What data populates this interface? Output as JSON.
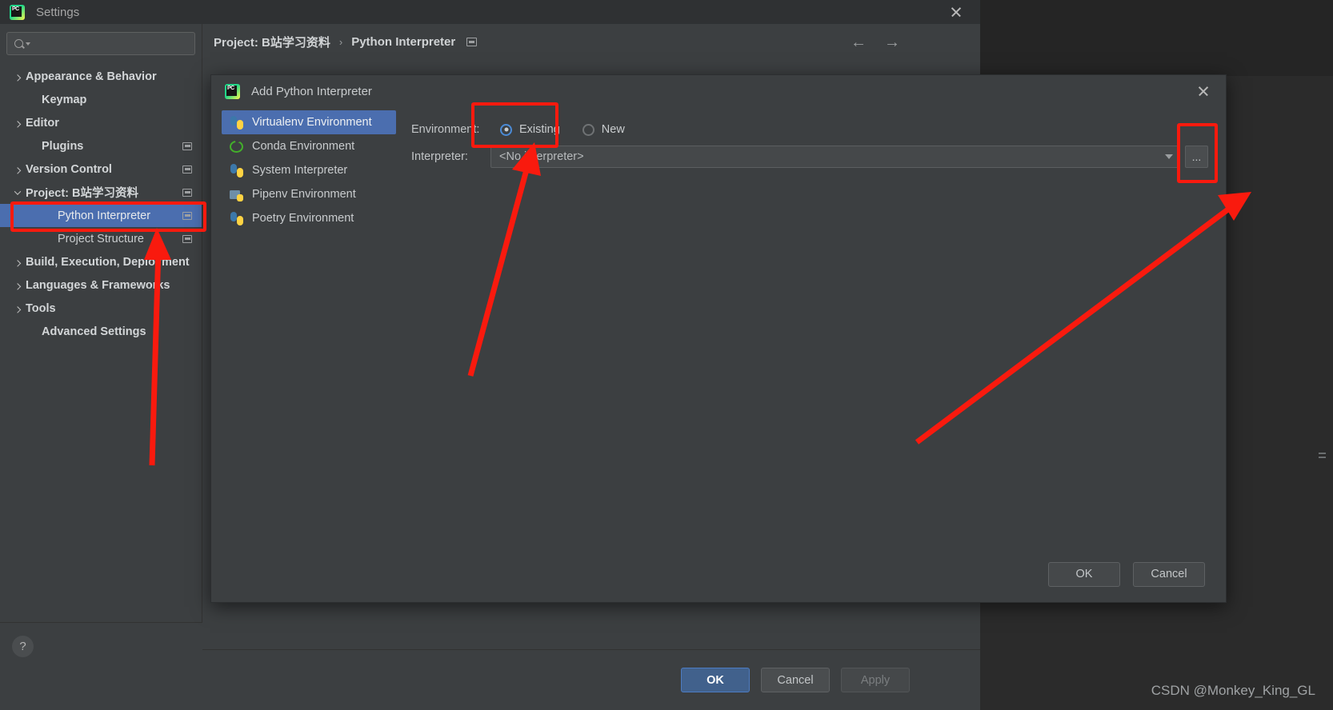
{
  "window": {
    "title": "Settings",
    "logo_text": "PC",
    "close_icon": "close-icon"
  },
  "search": {
    "value": "",
    "placeholder": ""
  },
  "sidebar": {
    "items": [
      {
        "label": "Appearance & Behavior",
        "indent": 0,
        "twisty": "collapsed",
        "bold": true,
        "badge": false,
        "selected": false
      },
      {
        "label": "Keymap",
        "indent": 1,
        "twisty": "none",
        "bold": true,
        "badge": false,
        "selected": false
      },
      {
        "label": "Editor",
        "indent": 0,
        "twisty": "collapsed",
        "bold": true,
        "badge": false,
        "selected": false
      },
      {
        "label": "Plugins",
        "indent": 1,
        "twisty": "none",
        "bold": true,
        "badge": true,
        "selected": false
      },
      {
        "label": "Version Control",
        "indent": 0,
        "twisty": "collapsed",
        "bold": true,
        "badge": true,
        "selected": false
      },
      {
        "label": "Project: B站学习资料",
        "indent": 0,
        "twisty": "expanded",
        "bold": true,
        "badge": true,
        "selected": false
      },
      {
        "label": "Python Interpreter",
        "indent": 2,
        "twisty": "none",
        "bold": false,
        "badge": true,
        "selected": true
      },
      {
        "label": "Project Structure",
        "indent": 2,
        "twisty": "none",
        "bold": false,
        "badge": true,
        "selected": false
      },
      {
        "label": "Build, Execution, Deployment",
        "indent": 0,
        "twisty": "collapsed",
        "bold": true,
        "badge": false,
        "selected": false
      },
      {
        "label": "Languages & Frameworks",
        "indent": 0,
        "twisty": "collapsed",
        "bold": true,
        "badge": false,
        "selected": false
      },
      {
        "label": "Tools",
        "indent": 0,
        "twisty": "collapsed",
        "bold": true,
        "badge": false,
        "selected": false
      },
      {
        "label": "Advanced Settings",
        "indent": 1,
        "twisty": "none",
        "bold": true,
        "badge": false,
        "selected": false
      }
    ],
    "help_label": "?"
  },
  "breadcrumb": {
    "project": "Project: B站学习资料",
    "separator": "›",
    "page": "Python Interpreter",
    "back_arrow": "←",
    "forward_arrow": "→"
  },
  "settings_footer": {
    "ok": "OK",
    "cancel": "Cancel",
    "apply": "Apply"
  },
  "dialog": {
    "title": "Add Python Interpreter",
    "logo_text": "PC",
    "env_list": [
      {
        "label": "Virtualenv Environment",
        "icon": "python-venv-icon",
        "selected": true
      },
      {
        "label": "Conda Environment",
        "icon": "conda-icon",
        "selected": false
      },
      {
        "label": "System Interpreter",
        "icon": "python-icon",
        "selected": false
      },
      {
        "label": "Pipenv Environment",
        "icon": "pipenv-folder-icon",
        "selected": false
      },
      {
        "label": "Poetry Environment",
        "icon": "poetry-icon",
        "selected": false
      }
    ],
    "environment_label": "Environment:",
    "radios": [
      {
        "label": "Existing",
        "checked": true
      },
      {
        "label": "New",
        "checked": false
      }
    ],
    "interpreter_label": "Interpreter:",
    "interpreter_value": "<No interpreter>",
    "browse_button": "...",
    "ok": "OK",
    "cancel": "Cancel"
  },
  "annotations": {
    "accent_color": "#f91a0e",
    "highlight_sidebar": "Python Interpreter",
    "highlight_existing": "Existing",
    "highlight_browse": "..."
  },
  "watermark": {
    "text": "CSDN @Monkey_King_GL"
  }
}
